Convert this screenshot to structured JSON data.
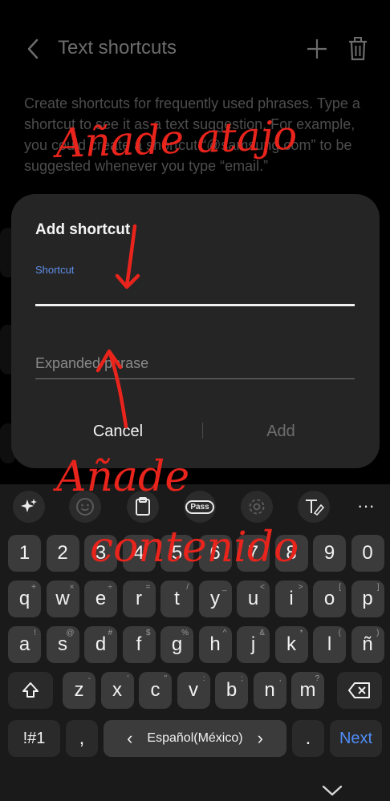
{
  "app": {
    "title": "Text shortcuts",
    "description": "Create shortcuts for frequently used phrases. Type a shortcut to see it as a text suggestion. For example, you could create a shortcut “@samsung.com” to be suggested whenever you type “email.”"
  },
  "dialog": {
    "title": "Add shortcut",
    "shortcut_label": "Shortcut",
    "expanded_placeholder": "Expanded phrase",
    "cancel_label": "Cancel",
    "add_label": "Add"
  },
  "keyboard": {
    "toolbar_icons": [
      "sparkle-icon",
      "emoji-icon",
      "clipboard-icon",
      "pass-icon",
      "settings-icon",
      "handwriting-icon",
      "more-icon"
    ],
    "pass_label": "Pass",
    "more_label": "···",
    "number_row": [
      "1",
      "2",
      "3",
      "4",
      "5",
      "6",
      "7",
      "8",
      "9",
      "0"
    ],
    "row1": [
      {
        "k": "q",
        "s": "+"
      },
      {
        "k": "w",
        "s": "×"
      },
      {
        "k": "e",
        "s": "÷"
      },
      {
        "k": "r",
        "s": "="
      },
      {
        "k": "t",
        "s": "/"
      },
      {
        "k": "y",
        "s": "_"
      },
      {
        "k": "u",
        "s": "<"
      },
      {
        "k": "i",
        "s": ">"
      },
      {
        "k": "o",
        "s": "["
      },
      {
        "k": "p",
        "s": "]"
      }
    ],
    "row2": [
      {
        "k": "a",
        "s": "!"
      },
      {
        "k": "s",
        "s": "@"
      },
      {
        "k": "d",
        "s": "#"
      },
      {
        "k": "f",
        "s": "$"
      },
      {
        "k": "g",
        "s": "%"
      },
      {
        "k": "h",
        "s": "^"
      },
      {
        "k": "j",
        "s": "&"
      },
      {
        "k": "k",
        "s": "*"
      },
      {
        "k": "l",
        "s": "("
      },
      {
        "k": "ñ",
        "s": ")"
      }
    ],
    "row3": [
      {
        "k": "z",
        "s": "-"
      },
      {
        "k": "x",
        "s": "'"
      },
      {
        "k": "c",
        "s": "\""
      },
      {
        "k": "v",
        "s": ":"
      },
      {
        "k": "b",
        "s": ";"
      },
      {
        "k": "n",
        "s": ","
      },
      {
        "k": "m",
        "s": "?"
      }
    ],
    "symbols_label": "!#1",
    "comma_label": ",",
    "language_label": "Español(México)",
    "period_label": ".",
    "next_label": "Next"
  },
  "annotations": {
    "top": "Añade atajo",
    "bottom_line1": "Añade",
    "bottom_line2": "contenido",
    "color": "#e8241c"
  }
}
